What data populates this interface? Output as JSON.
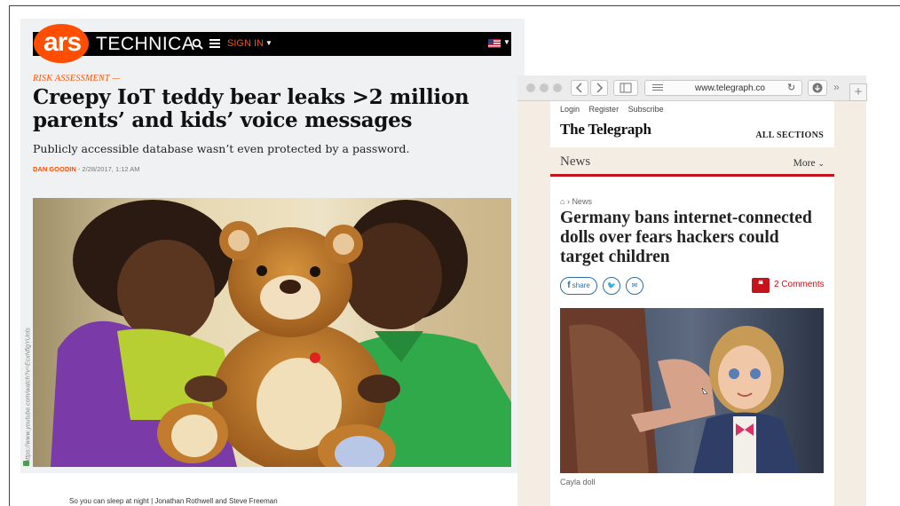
{
  "ars": {
    "logo": "ars",
    "wordmark": "TECHNICA",
    "signin_label": "SIGN IN",
    "kicker": "RISK ASSESSMENT —",
    "headline": "Creepy IoT teddy bear leaks >2 million parents’ and kids’ voice messages",
    "dek": "Publicly accessible database wasn’t even protected by a password.",
    "author": "DAN GOODIN",
    "dateline": " - 2/28/2017, 1:12 AM",
    "photo_credit": "https://www.youtube.com/watch?v=EcxNfigYUnls",
    "caption": "So you can sleep at night | Jonathan Rothwell and Steve Freeman",
    "icons": [
      "search-icon",
      "menu-icon",
      "us-flag-icon"
    ],
    "accent": "#ff4e00"
  },
  "browser": {
    "url": "www.telegraph.co",
    "icons": [
      "back-icon",
      "forward-icon",
      "sidebar-icon",
      "reader-icon",
      "reload-icon",
      "download-icon",
      "new-tab-icon"
    ]
  },
  "telegraph": {
    "top_links": [
      "Login",
      "Register",
      "Subscribe"
    ],
    "masthead": "The Telegraph",
    "all_sections": "ALL SECTIONS",
    "nav_section": "News",
    "nav_more": "More",
    "breadcrumb": "News",
    "headline": "Germany bans internet-connected dolls over fears hackers could target children",
    "share_label": "share",
    "comments": "2 Comments",
    "photo_caption": "Cayla doll",
    "accent": "#c6121a"
  }
}
